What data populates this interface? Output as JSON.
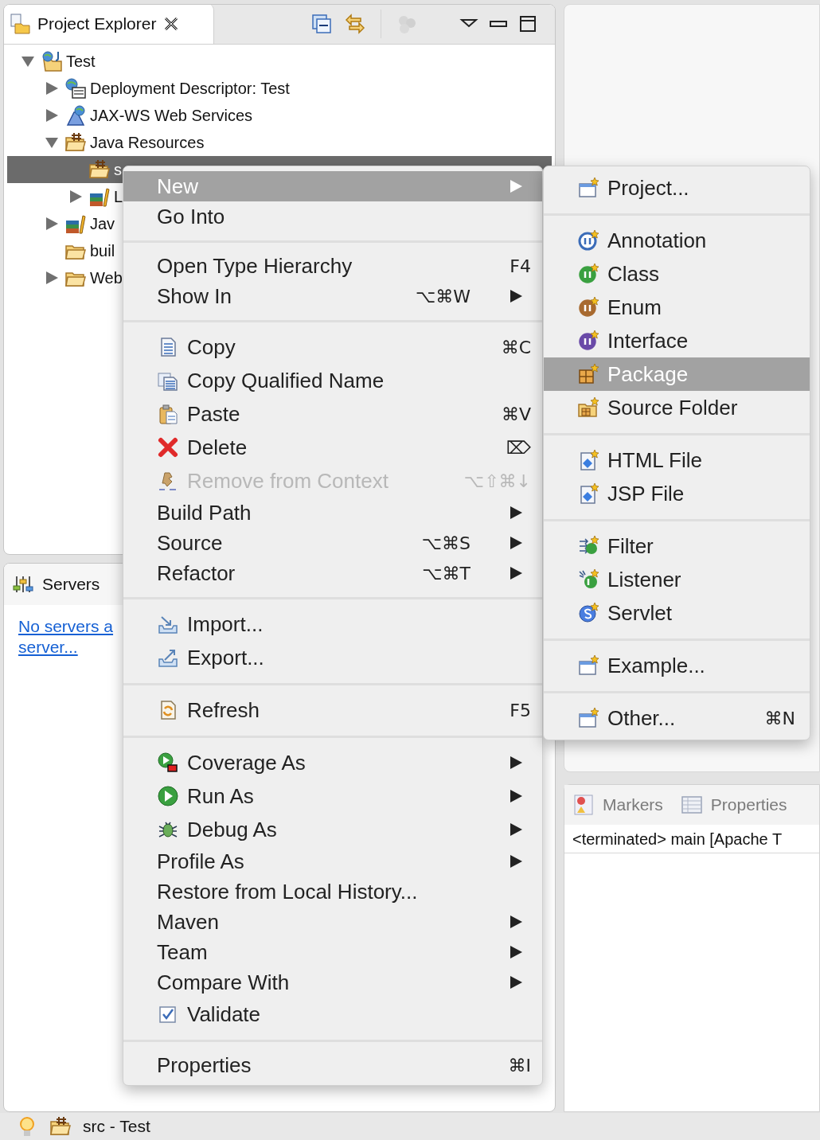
{
  "project_explorer": {
    "tab": {
      "title": "Project Explorer",
      "selected": true
    },
    "tree": [
      {
        "label": "Test",
        "expanded": true,
        "selected": false,
        "children": [
          {
            "label": "Deployment Descriptor: Test",
            "expanded": false,
            "selected": false
          },
          {
            "label": "JAX-WS Web Services",
            "expanded": false,
            "selected": false
          },
          {
            "label": "Java Resources",
            "expanded": true,
            "selected": false,
            "children": [
              {
                "label": "s",
                "selected": true
              },
              {
                "label": "L",
                "expanded": false,
                "selected": false
              }
            ]
          },
          {
            "label": "Jav",
            "expanded": false,
            "selected": false
          },
          {
            "label": "buil",
            "selected": false
          },
          {
            "label": "Web",
            "expanded": false,
            "selected": false
          }
        ]
      }
    ]
  },
  "servers": {
    "tab": {
      "title": "Servers",
      "selected": true
    },
    "link_lines": [
      "No servers a",
      "server..."
    ]
  },
  "console": {
    "tabs": [
      {
        "label": "Markers",
        "selected": false
      },
      {
        "label": "Properties",
        "selected": false
      }
    ],
    "line": "<terminated> main [Apache T"
  },
  "context_menu": {
    "sections": [
      [
        {
          "label": "New",
          "submenu": true,
          "selected": true,
          "disabled": false
        },
        {
          "label": "Go Into",
          "submenu": false,
          "selected": false,
          "disabled": false
        }
      ],
      [
        {
          "label": "Open Type Hierarchy",
          "shortcut": "F4",
          "submenu": false,
          "selected": false,
          "disabled": false
        },
        {
          "label": "Show In",
          "shortcut": "⌥⌘W",
          "submenu": true,
          "selected": false,
          "disabled": false
        }
      ],
      [
        {
          "label": "Copy",
          "shortcut": "⌘C",
          "submenu": false,
          "selected": false,
          "disabled": false
        },
        {
          "label": "Copy Qualified Name",
          "submenu": false,
          "selected": false,
          "disabled": false
        },
        {
          "label": "Paste",
          "shortcut": "⌘V",
          "submenu": false,
          "selected": false,
          "disabled": false
        },
        {
          "label": "Delete",
          "shortcut": "⌦",
          "submenu": false,
          "selected": false,
          "disabled": false
        },
        {
          "label": "Remove from Context",
          "shortcut": "⌥⇧⌘↓",
          "submenu": false,
          "selected": false,
          "disabled": true
        },
        {
          "label": "Build Path",
          "submenu": true,
          "selected": false,
          "disabled": false
        },
        {
          "label": "Source",
          "shortcut": "⌥⌘S",
          "submenu": true,
          "selected": false,
          "disabled": false
        },
        {
          "label": "Refactor",
          "shortcut": "⌥⌘T",
          "submenu": true,
          "selected": false,
          "disabled": false
        }
      ],
      [
        {
          "label": "Import...",
          "submenu": false,
          "selected": false,
          "disabled": false
        },
        {
          "label": "Export...",
          "submenu": false,
          "selected": false,
          "disabled": false
        }
      ],
      [
        {
          "label": "Refresh",
          "shortcut": "F5",
          "submenu": false,
          "selected": false,
          "disabled": false
        }
      ],
      [
        {
          "label": "Coverage As",
          "submenu": true,
          "selected": false,
          "disabled": false
        },
        {
          "label": "Run As",
          "submenu": true,
          "selected": false,
          "disabled": false
        },
        {
          "label": "Debug As",
          "submenu": true,
          "selected": false,
          "disabled": false
        },
        {
          "label": "Profile As",
          "submenu": true,
          "selected": false,
          "disabled": false
        },
        {
          "label": "Restore from Local History...",
          "submenu": false,
          "selected": false,
          "disabled": false
        },
        {
          "label": "Maven",
          "submenu": true,
          "selected": false,
          "disabled": false
        },
        {
          "label": "Team",
          "submenu": true,
          "selected": false,
          "disabled": false
        },
        {
          "label": "Compare With",
          "submenu": true,
          "selected": false,
          "disabled": false
        },
        {
          "label": "Validate",
          "submenu": false,
          "selected": false,
          "disabled": false
        }
      ],
      [
        {
          "label": "Properties",
          "shortcut": "⌘I",
          "submenu": false,
          "selected": false,
          "disabled": false
        }
      ]
    ]
  },
  "new_submenu": {
    "sections": [
      [
        {
          "label": "Project...",
          "selected": false
        }
      ],
      [
        {
          "label": "Annotation",
          "selected": false
        },
        {
          "label": "Class",
          "selected": false
        },
        {
          "label": "Enum",
          "selected": false
        },
        {
          "label": "Interface",
          "selected": false
        },
        {
          "label": "Package",
          "selected": true
        },
        {
          "label": "Source Folder",
          "selected": false
        }
      ],
      [
        {
          "label": "HTML File",
          "selected": false
        },
        {
          "label": "JSP File",
          "selected": false
        }
      ],
      [
        {
          "label": "Filter",
          "selected": false
        },
        {
          "label": "Listener",
          "selected": false
        },
        {
          "label": "Servlet",
          "selected": false
        }
      ],
      [
        {
          "label": "Example...",
          "selected": false
        }
      ],
      [
        {
          "label": "Other...",
          "shortcut": "⌘N",
          "selected": false
        }
      ]
    ]
  },
  "status_bar": {
    "text": "src - Test"
  }
}
